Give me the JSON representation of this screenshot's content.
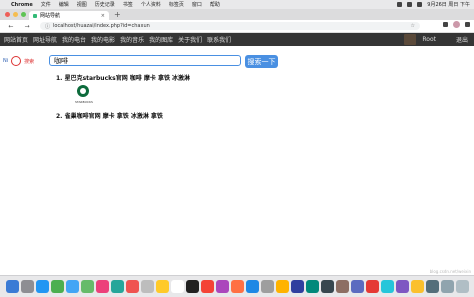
{
  "menubar": {
    "apple": "",
    "app": "Chrome",
    "items": [
      "文件",
      "编辑",
      "视图",
      "历史记录",
      "书签",
      "个人资料",
      "标签页",
      "窗口",
      "帮助"
    ],
    "clock": "9月26日 周日 下午"
  },
  "tab": {
    "title": "网站导航",
    "close": "×"
  },
  "new_tab": "+",
  "toolbar": {
    "back": "←",
    "forward": "→",
    "reload": "C",
    "url": "localhost/huazai/index.php?id=chaxun"
  },
  "site_nav": {
    "items": [
      "网站首页",
      "网址导航",
      "我的电台",
      "我的电影",
      "我的音乐",
      "我的图库",
      "关于我们",
      "联系我们"
    ],
    "user": "Root",
    "logout": "退出"
  },
  "search": {
    "logo_left": "Ni",
    "logo_right": "搜索",
    "query": "咖啡",
    "button": "搜索一下"
  },
  "results": [
    {
      "num": "1.",
      "title": "星巴克starbucks官网 咖啡 摩卡 拿铁 冰激淋",
      "caption": "STARBUCKS"
    },
    {
      "num": "2.",
      "title": "雀巢咖啡官网 摩卡 拿铁 冰激淋 拿铁"
    }
  ],
  "watermark": "blog.csdn.net/weixin",
  "colors": {
    "accent": "#4a90e2",
    "nav_bg": "#353535"
  }
}
